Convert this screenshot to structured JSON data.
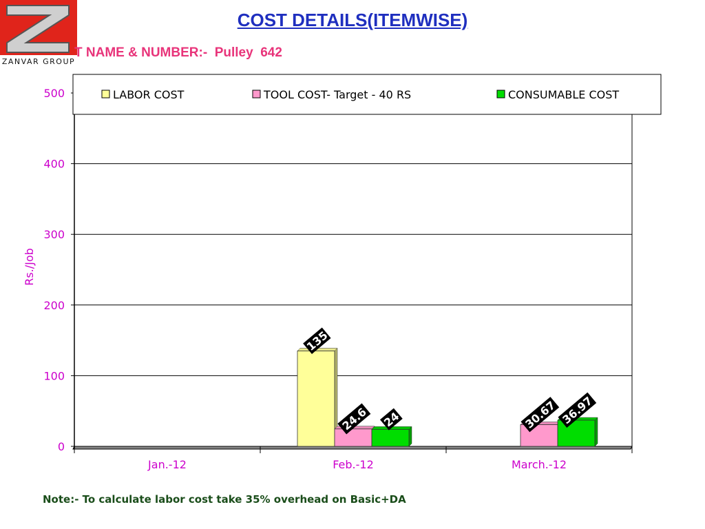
{
  "header": {
    "title": "COST DETAILS(ITEMWISE)",
    "subtitle": "T NAME & NUMBER:-  Pulley  642"
  },
  "logo": {
    "text": "ZANVAR GROUP",
    "icon": "z-logo-icon",
    "color": "#e0241b"
  },
  "note": "Note:- To calculate labor cost take 35% overhead on Basic+DA",
  "chart_data": {
    "type": "bar",
    "title": "",
    "xlabel": "",
    "ylabel": "Rs./Job",
    "ylim": [
      0,
      500
    ],
    "yticks": [
      0,
      100,
      200,
      300,
      400,
      500
    ],
    "grid": true,
    "legend_position": "top",
    "categories": [
      "Jan.-12",
      "Feb.-12",
      "March.-12"
    ],
    "series": [
      {
        "name": "LABOR COST",
        "color": "#ffff99",
        "values": [
          null,
          135,
          null
        ],
        "labels": [
          "",
          "135",
          ""
        ]
      },
      {
        "name": "TOOL COST- Target - 40 RS",
        "color": "#ff99cc",
        "values": [
          null,
          24.6,
          30.67
        ],
        "labels": [
          "",
          "24.6",
          "30.67"
        ]
      },
      {
        "name": "CONSUMABLE COST",
        "color": "#00dd00",
        "values": [
          null,
          24,
          36.97
        ],
        "labels": [
          "",
          "24",
          "36.97"
        ]
      }
    ]
  }
}
